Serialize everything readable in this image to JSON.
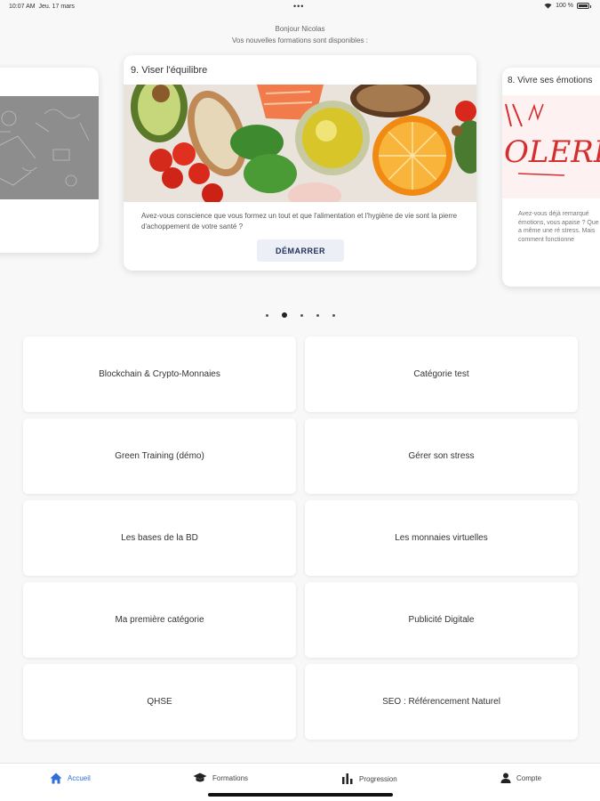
{
  "status_bar": {
    "time": "10:07 AM",
    "date": "Jeu. 17 mars",
    "dots": "•••",
    "battery": "100 %"
  },
  "header": {
    "greeting": "Bonjour Nicolas",
    "subtitle": "Vos nouvelles formations sont disponibles :"
  },
  "carousel": {
    "center": {
      "title": "9. Viser l'équilibre",
      "description": "Avez-vous conscience que vous formez un tout et que l'alimentation et l'hygiène de vie sont la pierre d'achoppement de votre santé ?",
      "button": "DÉMARRER"
    },
    "right": {
      "title": "8. Vivre ses émotions",
      "image_text": "OLERE",
      "description": "Avez-vous déjà remarqué émotions, vous apaise ? Que cela a même une ré stress. Mais comment fonctionne"
    },
    "active_index": 1,
    "page_count": 5
  },
  "categories": [
    "Blockchain & Crypto-Monnaies",
    "Catégorie test",
    "Green Training (démo)",
    "Gérer son stress",
    "Les bases de la BD",
    "Les monnaies virtuelles",
    "Ma première catégorie",
    "Publicité Digitale",
    "QHSE",
    "SEO : Référencement Naturel"
  ],
  "bottom_nav": {
    "home": "Accueil",
    "courses": "Formations",
    "progress": "Progression",
    "account": "Compte"
  },
  "colors": {
    "accent": "#2f6fd6",
    "button_text": "#1f2d5c",
    "background": "#f8f8f8"
  }
}
